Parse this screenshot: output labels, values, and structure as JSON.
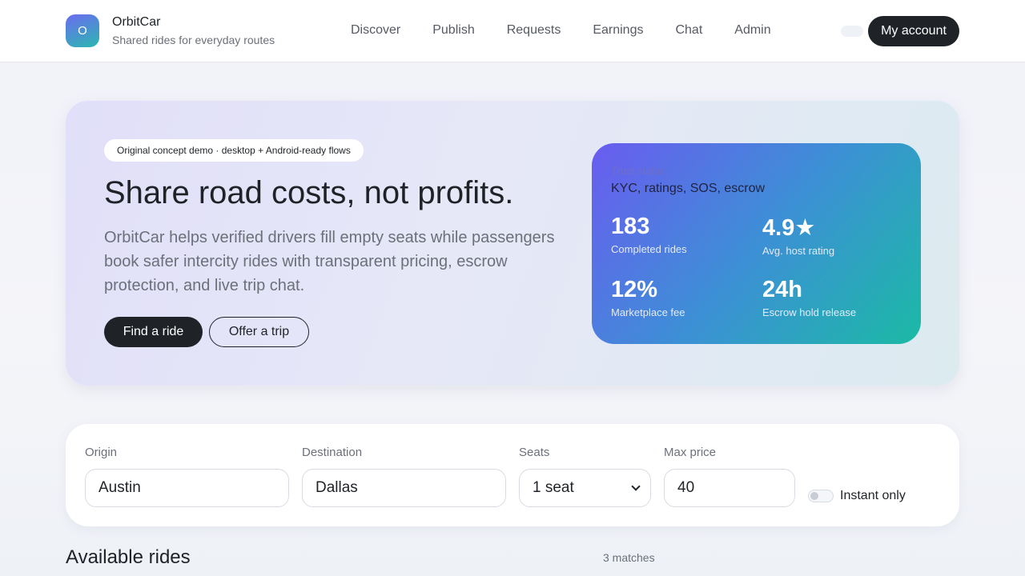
{
  "brand": {
    "logo_letter": "O",
    "name": "OrbitCar",
    "tagline": "Shared rides for everyday routes"
  },
  "nav": {
    "items": [
      {
        "label": "Discover"
      },
      {
        "label": "Publish"
      },
      {
        "label": "Requests"
      },
      {
        "label": "Earnings"
      },
      {
        "label": "Chat"
      },
      {
        "label": "Admin"
      }
    ],
    "account_label": "My account"
  },
  "hero": {
    "pill": "Original concept demo · desktop + Android-ready flows",
    "title": "Share road costs, not profits.",
    "description": "OrbitCar helps verified drivers fill empty seats while passengers book safer intercity rides with transparent pricing, escrow protection, and live trip chat.",
    "primary_button": "Find a ride",
    "secondary_button": "Offer a trip"
  },
  "trust": {
    "label": "Trust status",
    "value": "KYC, ratings, SOS, escrow",
    "stats": [
      {
        "number": "183",
        "label": "Completed rides"
      },
      {
        "number": "4.9★",
        "label": "Avg. host rating"
      },
      {
        "number": "12%",
        "label": "Marketplace fee"
      },
      {
        "number": "24h",
        "label": "Escrow hold release"
      }
    ]
  },
  "search": {
    "origin": {
      "label": "Origin",
      "value": "Austin"
    },
    "destination": {
      "label": "Destination",
      "value": "Dallas"
    },
    "seats": {
      "label": "Seats",
      "value": "1 seat"
    },
    "max_price": {
      "label": "Max price",
      "value": "40"
    },
    "instant_only": {
      "label": "Instant only",
      "checked": false
    }
  },
  "results": {
    "title": "Available rides",
    "count": "3 matches"
  },
  "colors": {
    "accent_dark": "#1f2328",
    "gradient_start": "#6a5cf0",
    "gradient_end": "#1bbaa5"
  }
}
